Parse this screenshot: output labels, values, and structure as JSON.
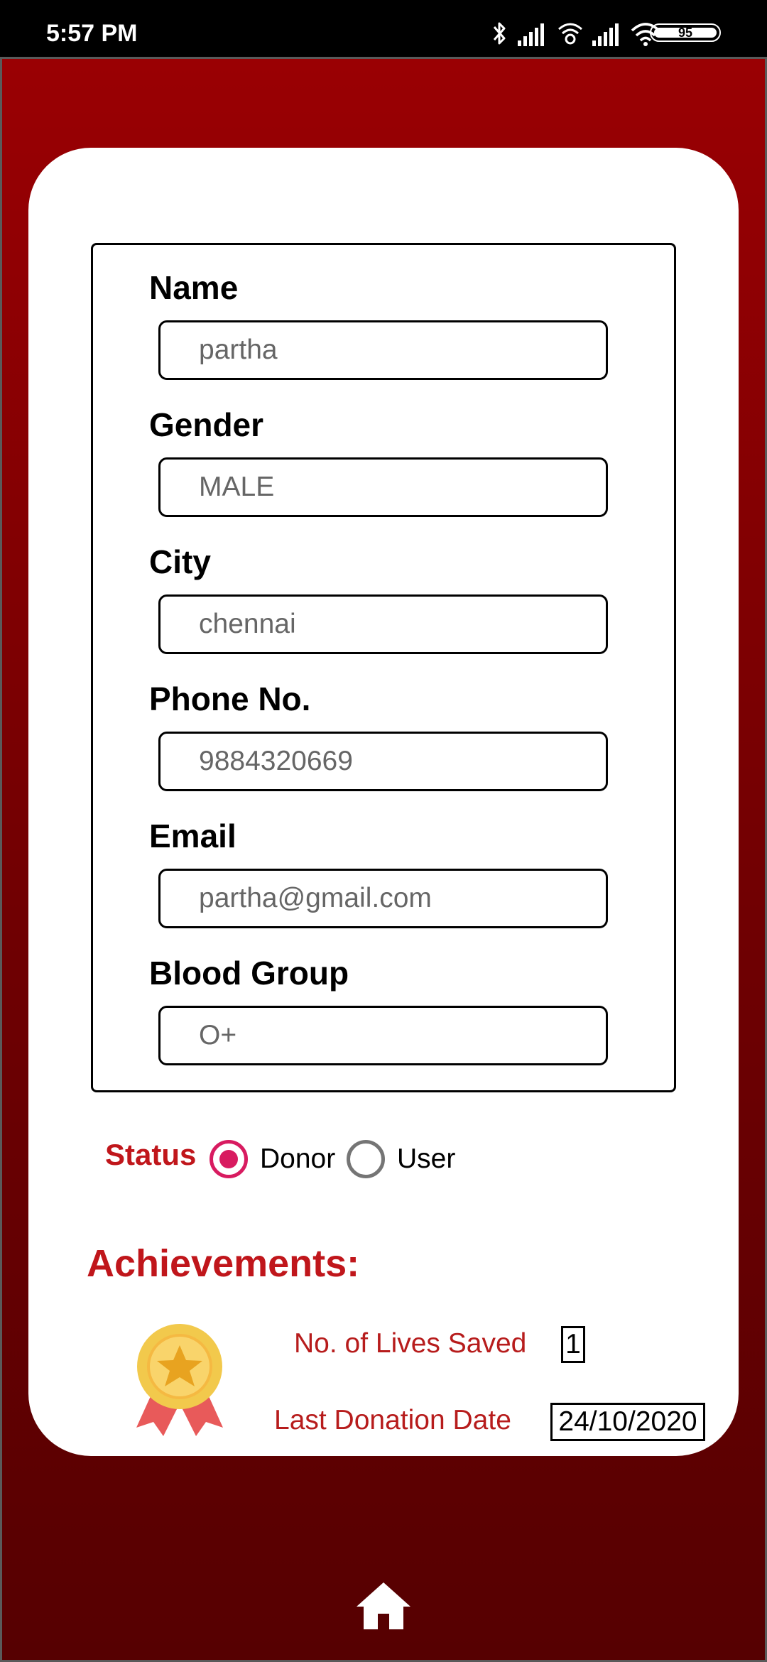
{
  "status_bar": {
    "time": "5:57 PM",
    "battery": "95",
    "icons": [
      "bluetooth-icon",
      "signal-icon",
      "wifi-calling-icon",
      "signal-icon",
      "wifi-icon",
      "battery-icon"
    ]
  },
  "form": {
    "fields": [
      {
        "label": "Name",
        "value": "partha"
      },
      {
        "label": "Gender",
        "value": "MALE"
      },
      {
        "label": "City",
        "value": "chennai"
      },
      {
        "label": "Phone No.",
        "value": "9884320669"
      },
      {
        "label": "Email",
        "value": "partha@gmail.com"
      },
      {
        "label": "Blood Group",
        "value": "O+"
      }
    ]
  },
  "status": {
    "label": "Status",
    "options": [
      {
        "label": "Donor",
        "checked": true
      },
      {
        "label": "User",
        "checked": false
      }
    ]
  },
  "achievements": {
    "title": "Achievements:",
    "lives_saved_label": "No. of Lives Saved",
    "lives_saved_value": "1",
    "last_donation_label": "Last Donation Date",
    "last_donation_value": "24/10/2020"
  },
  "nav": {
    "home_icon": "home-icon"
  },
  "colors": {
    "accent_red": "#c0161b",
    "radio_pink": "#d81b60",
    "background_top": "#9a0003",
    "background_bottom": "#560001"
  }
}
